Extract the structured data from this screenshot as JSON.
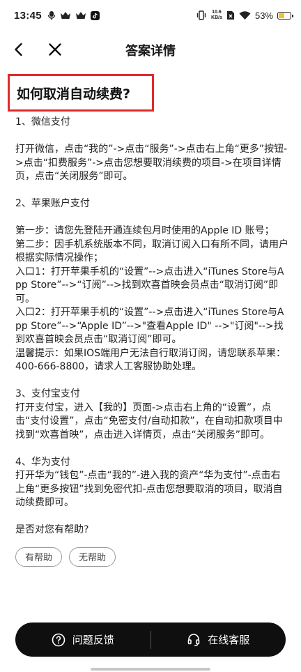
{
  "status_bar": {
    "time": "13:45",
    "net_speed_value": "10.6",
    "net_speed_unit": "KB/s",
    "battery": "53%",
    "battery_level": 0.53,
    "battery_color": "#f2c230"
  },
  "nav": {
    "title": "答案详情",
    "back_icon": "chevron-left-icon",
    "close_icon": "close-icon"
  },
  "question": {
    "title": "如何取消自动续费?",
    "highlight_color": "#e02b2b"
  },
  "answer_text": "1、微信支付\n\n打开微信，点击“我的”->点击“服务”->点击右上角“更多”按钮->点击“扣费服务”->点击您想要取消续费的项目->在项目详情页，点击“关闭服务”即可。\n\n2、苹果账户支付\n\n第一步：请您先登陆开通连续包月时使用的Apple ID 账号；\n第二步：因手机系统版本不同，取消订阅入口有所不同，请用户根据实际情况操作；\n入口1：打开苹果手机的“设置”-->点击进入“iTunes Store与App Store”-->“订阅”-->找到欢喜首映会员点击“取消订阅”即可。\n入口2：打开苹果手机的“设置”-->点击进入“iTunes Store与App Store”-->“Apple ID”-->\"查看Apple ID\" -->\"订阅\"-->找到欢喜首映会员点击“取消订阅”即可。\n温馨提示：如果IOS端用户无法自行取消订阅，请您联系苹果：400-666-8800，请求人工客服协助处理。\n\n3、支付宝支付\n打开支付宝，进入【我的】页面->点击右上角的“设置”，点击“支付设置”，点击“免密支付/自动扣款”，在自动扣款项目中找到“欢喜首映”，点击进入详情页，点击“关闭服务”即可。\n\n4、华为支付\n打开华为“钱包”-点击“我的”-进入我的资产“华为支付”-点击右上角“更多按钮”找到免密代扣-点击您想要取消的项目，取消自动续费即可。\n\n是否对您有帮助?",
  "feedback": {
    "helpful": "有帮助",
    "not_helpful": "无帮助"
  },
  "bottom": {
    "feedback_label": "问题反馈",
    "feedback_icon": "question-circle-icon",
    "service_label": "在线客服",
    "service_icon": "headset-icon",
    "background": "#0f0f0f"
  }
}
